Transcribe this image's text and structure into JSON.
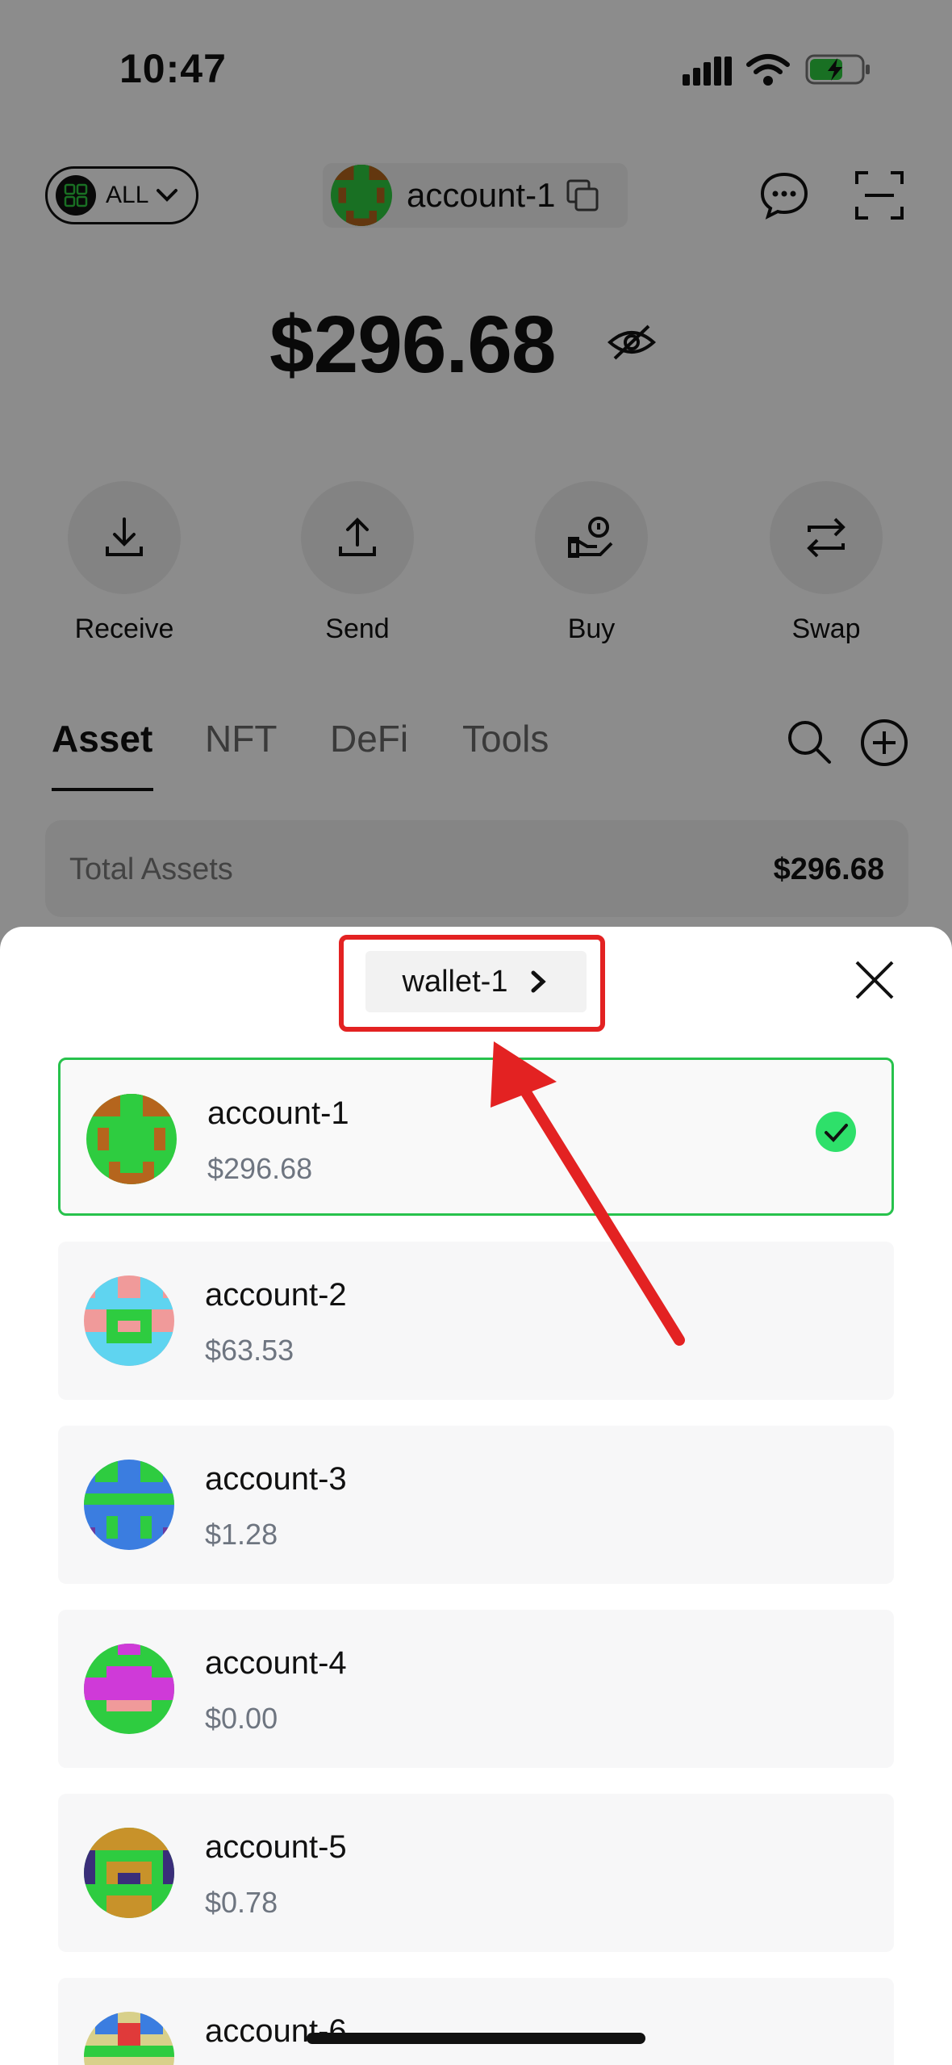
{
  "status_bar": {
    "time": "10:47",
    "icons": [
      "cellular-signal-icon",
      "wifi-icon",
      "battery-charging-icon"
    ],
    "battery_color": "#2ecc40"
  },
  "header": {
    "network_chip_label": "ALL",
    "account_name": "account-1",
    "icons": [
      "grid-icon",
      "chevron-down-icon",
      "copy-icon",
      "chat-icon",
      "scan-icon"
    ]
  },
  "balance": {
    "amount": "$296.68"
  },
  "actions": [
    {
      "label": "Receive",
      "icon": "receive-icon"
    },
    {
      "label": "Send",
      "icon": "send-icon"
    },
    {
      "label": "Buy",
      "icon": "buy-icon"
    },
    {
      "label": "Swap",
      "icon": "swap-icon"
    }
  ],
  "tabs": [
    {
      "label": "Asset",
      "active": true
    },
    {
      "label": "NFT",
      "active": false
    },
    {
      "label": "DeFi",
      "active": false
    },
    {
      "label": "Tools",
      "active": false
    }
  ],
  "total_assets": {
    "label": "Total Assets",
    "value": "$296.68"
  },
  "sheet": {
    "wallet_label": "wallet-1",
    "accounts": [
      {
        "name": "account-1",
        "value": "$296.68",
        "selected": true
      },
      {
        "name": "account-2",
        "value": "$63.53",
        "selected": false
      },
      {
        "name": "account-3",
        "value": "$1.28",
        "selected": false
      },
      {
        "name": "account-4",
        "value": "$0.00",
        "selected": false
      },
      {
        "name": "account-5",
        "value": "$0.78",
        "selected": false
      },
      {
        "name": "account-6",
        "value": "",
        "selected": false
      }
    ]
  },
  "colors": {
    "selected_border": "#27c24c",
    "check_fill": "#2ee06a",
    "annotation_red": "#e32222",
    "secondary_text": "#6e7580"
  }
}
